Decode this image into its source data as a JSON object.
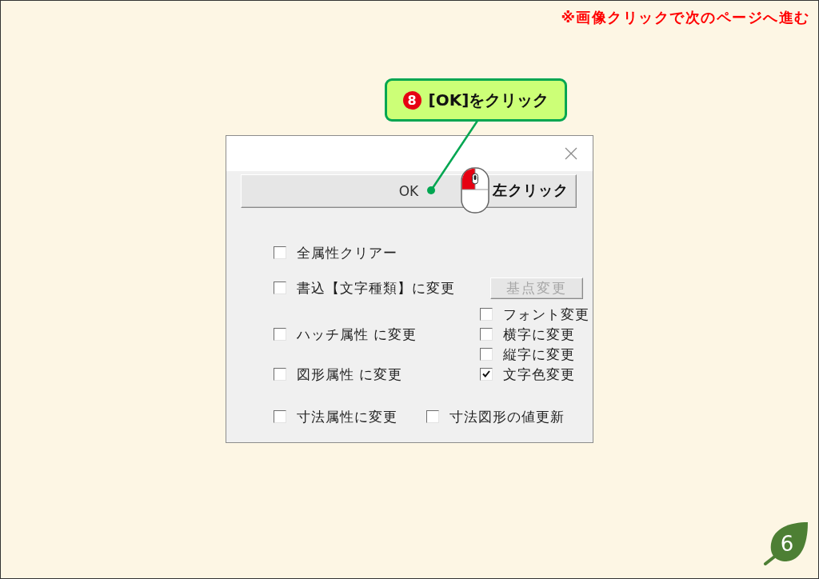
{
  "note": "※画像クリックで次のページへ進む",
  "callout": {
    "step": "8",
    "text": "[OK]をクリック"
  },
  "dialog": {
    "ok_button": {
      "label": "OK"
    },
    "click_hint": {
      "label": "左クリック"
    },
    "options": [
      {
        "label": "全属性クリアー",
        "checked": false
      },
      {
        "label": "書込【文字種類】に変更",
        "checked": false
      },
      {
        "label": "ハッチ属性 に変更",
        "checked": false
      },
      {
        "label": "図形属性 に変更",
        "checked": false
      }
    ],
    "base_point_button": {
      "label": "基点変更",
      "disabled": true
    },
    "text_options": [
      {
        "label": "フォント変更",
        "checked": false
      },
      {
        "label": "横字に変更",
        "checked": false
      },
      {
        "label": "縦字に変更",
        "checked": false
      },
      {
        "label": "文字色変更",
        "checked": true
      }
    ],
    "dimension_options": [
      {
        "label": "寸法属性に変更",
        "checked": false
      },
      {
        "label": "寸法図形の値更新",
        "checked": false
      }
    ]
  },
  "page_number": "6"
}
